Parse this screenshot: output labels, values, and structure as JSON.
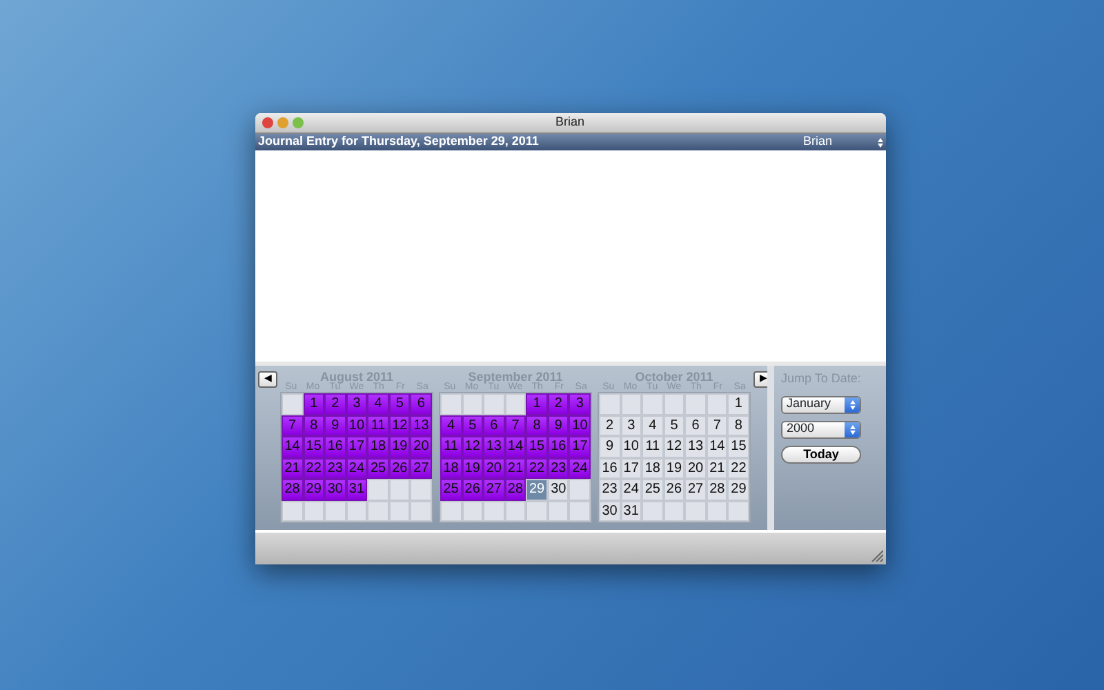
{
  "window": {
    "title": "Brian"
  },
  "header": {
    "title": "Journal Entry for Thursday, September 29, 2011",
    "user_popup": "Brian"
  },
  "calendar": {
    "prev_button": "◀",
    "next_button": "▶",
    "months": [
      {
        "title": "August 2011",
        "weekdays": [
          "Su",
          "Mo",
          "Tu",
          "We",
          "Th",
          "Fr",
          "Sa"
        ],
        "weeks": [
          [
            {
              "kind": "blank"
            },
            {
              "kind": "day",
              "day": "1",
              "entry": true,
              "selected": false
            },
            {
              "kind": "day",
              "day": "2",
              "entry": true,
              "selected": false
            },
            {
              "kind": "day",
              "day": "3",
              "entry": true,
              "selected": false
            },
            {
              "kind": "day",
              "day": "4",
              "entry": true,
              "selected": false
            },
            {
              "kind": "day",
              "day": "5",
              "entry": true,
              "selected": false
            },
            {
              "kind": "day",
              "day": "6",
              "entry": true,
              "selected": false
            }
          ],
          [
            {
              "kind": "day",
              "day": "7",
              "entry": true,
              "selected": false
            },
            {
              "kind": "day",
              "day": "8",
              "entry": true,
              "selected": false
            },
            {
              "kind": "day",
              "day": "9",
              "entry": true,
              "selected": false
            },
            {
              "kind": "day",
              "day": "10",
              "entry": true,
              "selected": false
            },
            {
              "kind": "day",
              "day": "11",
              "entry": true,
              "selected": false
            },
            {
              "kind": "day",
              "day": "12",
              "entry": true,
              "selected": false
            },
            {
              "kind": "day",
              "day": "13",
              "entry": true,
              "selected": false
            }
          ],
          [
            {
              "kind": "day",
              "day": "14",
              "entry": true,
              "selected": false
            },
            {
              "kind": "day",
              "day": "15",
              "entry": true,
              "selected": false
            },
            {
              "kind": "day",
              "day": "16",
              "entry": true,
              "selected": false
            },
            {
              "kind": "day",
              "day": "17",
              "entry": true,
              "selected": false
            },
            {
              "kind": "day",
              "day": "18",
              "entry": true,
              "selected": false
            },
            {
              "kind": "day",
              "day": "19",
              "entry": true,
              "selected": false
            },
            {
              "kind": "day",
              "day": "20",
              "entry": true,
              "selected": false
            }
          ],
          [
            {
              "kind": "day",
              "day": "21",
              "entry": true,
              "selected": false
            },
            {
              "kind": "day",
              "day": "22",
              "entry": true,
              "selected": false
            },
            {
              "kind": "day",
              "day": "23",
              "entry": true,
              "selected": false
            },
            {
              "kind": "day",
              "day": "24",
              "entry": true,
              "selected": false
            },
            {
              "kind": "day",
              "day": "25",
              "entry": true,
              "selected": false
            },
            {
              "kind": "day",
              "day": "26",
              "entry": true,
              "selected": false
            },
            {
              "kind": "day",
              "day": "27",
              "entry": true,
              "selected": false
            }
          ],
          [
            {
              "kind": "day",
              "day": "28",
              "entry": true,
              "selected": false
            },
            {
              "kind": "day",
              "day": "29",
              "entry": true,
              "selected": false
            },
            {
              "kind": "day",
              "day": "30",
              "entry": true,
              "selected": false
            },
            {
              "kind": "day",
              "day": "31",
              "entry": true,
              "selected": false
            },
            {
              "kind": "blank"
            },
            {
              "kind": "blank"
            },
            {
              "kind": "blank"
            }
          ],
          [
            {
              "kind": "blank"
            },
            {
              "kind": "blank"
            },
            {
              "kind": "blank"
            },
            {
              "kind": "blank"
            },
            {
              "kind": "blank"
            },
            {
              "kind": "blank"
            },
            {
              "kind": "blank"
            }
          ]
        ]
      },
      {
        "title": "September 2011",
        "weekdays": [
          "Su",
          "Mo",
          "Tu",
          "We",
          "Th",
          "Fr",
          "Sa"
        ],
        "weeks": [
          [
            {
              "kind": "blank"
            },
            {
              "kind": "blank"
            },
            {
              "kind": "blank"
            },
            {
              "kind": "blank"
            },
            {
              "kind": "day",
              "day": "1",
              "entry": true,
              "selected": false
            },
            {
              "kind": "day",
              "day": "2",
              "entry": true,
              "selected": false
            },
            {
              "kind": "day",
              "day": "3",
              "entry": true,
              "selected": false
            }
          ],
          [
            {
              "kind": "day",
              "day": "4",
              "entry": true,
              "selected": false
            },
            {
              "kind": "day",
              "day": "5",
              "entry": true,
              "selected": false
            },
            {
              "kind": "day",
              "day": "6",
              "entry": true,
              "selected": false
            },
            {
              "kind": "day",
              "day": "7",
              "entry": true,
              "selected": false
            },
            {
              "kind": "day",
              "day": "8",
              "entry": true,
              "selected": false
            },
            {
              "kind": "day",
              "day": "9",
              "entry": true,
              "selected": false
            },
            {
              "kind": "day",
              "day": "10",
              "entry": true,
              "selected": false
            }
          ],
          [
            {
              "kind": "day",
              "day": "11",
              "entry": true,
              "selected": false
            },
            {
              "kind": "day",
              "day": "12",
              "entry": true,
              "selected": false
            },
            {
              "kind": "day",
              "day": "13",
              "entry": true,
              "selected": false
            },
            {
              "kind": "day",
              "day": "14",
              "entry": true,
              "selected": false
            },
            {
              "kind": "day",
              "day": "15",
              "entry": true,
              "selected": false
            },
            {
              "kind": "day",
              "day": "16",
              "entry": true,
              "selected": false
            },
            {
              "kind": "day",
              "day": "17",
              "entry": true,
              "selected": false
            }
          ],
          [
            {
              "kind": "day",
              "day": "18",
              "entry": true,
              "selected": false
            },
            {
              "kind": "day",
              "day": "19",
              "entry": true,
              "selected": false
            },
            {
              "kind": "day",
              "day": "20",
              "entry": true,
              "selected": false
            },
            {
              "kind": "day",
              "day": "21",
              "entry": true,
              "selected": false
            },
            {
              "kind": "day",
              "day": "22",
              "entry": true,
              "selected": false
            },
            {
              "kind": "day",
              "day": "23",
              "entry": true,
              "selected": false
            },
            {
              "kind": "day",
              "day": "24",
              "entry": true,
              "selected": false
            }
          ],
          [
            {
              "kind": "day",
              "day": "25",
              "entry": true,
              "selected": false
            },
            {
              "kind": "day",
              "day": "26",
              "entry": true,
              "selected": false
            },
            {
              "kind": "day",
              "day": "27",
              "entry": true,
              "selected": false
            },
            {
              "kind": "day",
              "day": "28",
              "entry": true,
              "selected": false
            },
            {
              "kind": "day",
              "day": "29",
              "entry": false,
              "selected": true
            },
            {
              "kind": "day",
              "day": "30",
              "entry": false,
              "selected": false
            },
            {
              "kind": "blank"
            }
          ],
          [
            {
              "kind": "blank"
            },
            {
              "kind": "blank"
            },
            {
              "kind": "blank"
            },
            {
              "kind": "blank"
            },
            {
              "kind": "blank"
            },
            {
              "kind": "blank"
            },
            {
              "kind": "blank"
            }
          ]
        ]
      },
      {
        "title": "October 2011",
        "weekdays": [
          "Su",
          "Mo",
          "Tu",
          "We",
          "Th",
          "Fr",
          "Sa"
        ],
        "weeks": [
          [
            {
              "kind": "blank"
            },
            {
              "kind": "blank"
            },
            {
              "kind": "blank"
            },
            {
              "kind": "blank"
            },
            {
              "kind": "blank"
            },
            {
              "kind": "blank"
            },
            {
              "kind": "day",
              "day": "1",
              "entry": false,
              "selected": false
            }
          ],
          [
            {
              "kind": "day",
              "day": "2",
              "entry": false,
              "selected": false
            },
            {
              "kind": "day",
              "day": "3",
              "entry": false,
              "selected": false
            },
            {
              "kind": "day",
              "day": "4",
              "entry": false,
              "selected": false
            },
            {
              "kind": "day",
              "day": "5",
              "entry": false,
              "selected": false
            },
            {
              "kind": "day",
              "day": "6",
              "entry": false,
              "selected": false
            },
            {
              "kind": "day",
              "day": "7",
              "entry": false,
              "selected": false
            },
            {
              "kind": "day",
              "day": "8",
              "entry": false,
              "selected": false
            }
          ],
          [
            {
              "kind": "day",
              "day": "9",
              "entry": false,
              "selected": false
            },
            {
              "kind": "day",
              "day": "10",
              "entry": false,
              "selected": false
            },
            {
              "kind": "day",
              "day": "11",
              "entry": false,
              "selected": false
            },
            {
              "kind": "day",
              "day": "12",
              "entry": false,
              "selected": false
            },
            {
              "kind": "day",
              "day": "13",
              "entry": false,
              "selected": false
            },
            {
              "kind": "day",
              "day": "14",
              "entry": false,
              "selected": false
            },
            {
              "kind": "day",
              "day": "15",
              "entry": false,
              "selected": false
            }
          ],
          [
            {
              "kind": "day",
              "day": "16",
              "entry": false,
              "selected": false
            },
            {
              "kind": "day",
              "day": "17",
              "entry": false,
              "selected": false
            },
            {
              "kind": "day",
              "day": "18",
              "entry": false,
              "selected": false
            },
            {
              "kind": "day",
              "day": "19",
              "entry": false,
              "selected": false
            },
            {
              "kind": "day",
              "day": "20",
              "entry": false,
              "selected": false
            },
            {
              "kind": "day",
              "day": "21",
              "entry": false,
              "selected": false
            },
            {
              "kind": "day",
              "day": "22",
              "entry": false,
              "selected": false
            }
          ],
          [
            {
              "kind": "day",
              "day": "23",
              "entry": false,
              "selected": false
            },
            {
              "kind": "day",
              "day": "24",
              "entry": false,
              "selected": false
            },
            {
              "kind": "day",
              "day": "25",
              "entry": false,
              "selected": false
            },
            {
              "kind": "day",
              "day": "26",
              "entry": false,
              "selected": false
            },
            {
              "kind": "day",
              "day": "27",
              "entry": false,
              "selected": false
            },
            {
              "kind": "day",
              "day": "28",
              "entry": false,
              "selected": false
            },
            {
              "kind": "day",
              "day": "29",
              "entry": false,
              "selected": false
            }
          ],
          [
            {
              "kind": "day",
              "day": "30",
              "entry": false,
              "selected": false
            },
            {
              "kind": "day",
              "day": "31",
              "entry": false,
              "selected": false
            },
            {
              "kind": "blank"
            },
            {
              "kind": "blank"
            },
            {
              "kind": "blank"
            },
            {
              "kind": "blank"
            },
            {
              "kind": "blank"
            }
          ]
        ]
      }
    ]
  },
  "jump": {
    "label": "Jump To Date:",
    "month": "January",
    "year": "2000",
    "today_button": "Today"
  }
}
